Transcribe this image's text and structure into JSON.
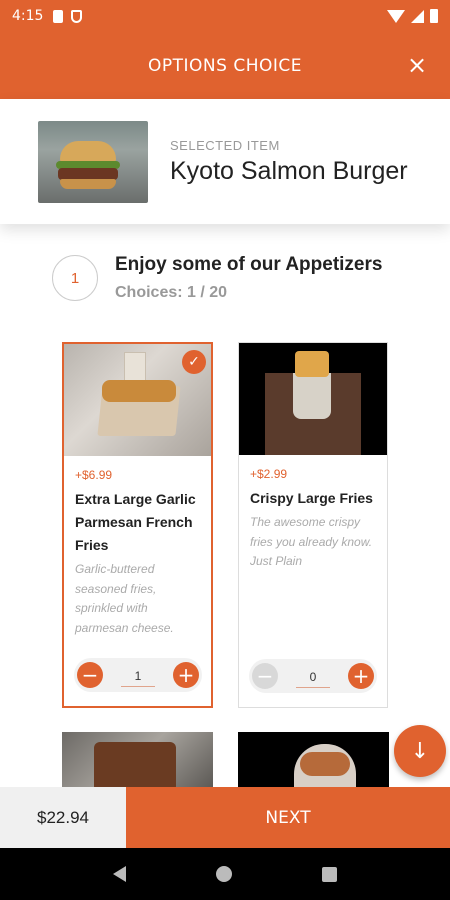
{
  "status_bar": {
    "time": "4:15"
  },
  "header": {
    "title": "OPTIONS CHOICE",
    "close_icon": "×"
  },
  "selected_item": {
    "label": "SELECTED ITEM",
    "name": "Kyoto Salmon Burger"
  },
  "step": {
    "number": "1",
    "title": "Enjoy some of our Appetizers",
    "choices": "Choices: 1 / 20"
  },
  "options": [
    {
      "price": "+$6.99",
      "name": "Extra Large Garlic Parmesan French Fries",
      "description": "Garlic-buttered seasoned fries, sprinkled with parmesan cheese.",
      "quantity": "1",
      "selected": true
    },
    {
      "price": "+$2.99",
      "name": "Crispy Large Fries",
      "description": "The awesome crispy fries you already know. Just Plain",
      "quantity": "0",
      "selected": false
    }
  ],
  "icons": {
    "check": "✓",
    "minus": "−",
    "plus": "+",
    "scroll_down": "↓"
  },
  "footer": {
    "total": "$22.94",
    "next_label": "NEXT"
  },
  "colors": {
    "accent": "#e0622f",
    "muted_text": "#999999"
  }
}
